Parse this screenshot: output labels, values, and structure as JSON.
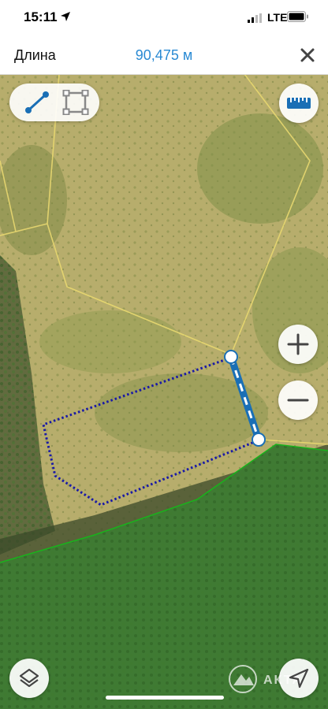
{
  "status_bar": {
    "time": "15:11",
    "network": "LTE"
  },
  "header": {
    "label": "Длина",
    "value": "90,475 м"
  },
  "icons": {
    "location": "location-arrow-icon",
    "signal": "signal-bars-icon",
    "battery": "battery-icon",
    "close": "close-icon",
    "line_tool": "line-tool-icon",
    "polygon_tool": "polygon-tool-icon",
    "ruler": "ruler-icon",
    "zoom_in": "plus-icon",
    "zoom_out": "minus-icon",
    "layers": "layers-icon",
    "navigate": "navigation-arrow-icon"
  },
  "watermark": {
    "text": "АКТА"
  },
  "colors": {
    "accent": "#2a8ad3",
    "parcel_boundary": "#e8d870",
    "plot_outline": "#1a1aa6",
    "forest_boundary": "#19b31c"
  }
}
